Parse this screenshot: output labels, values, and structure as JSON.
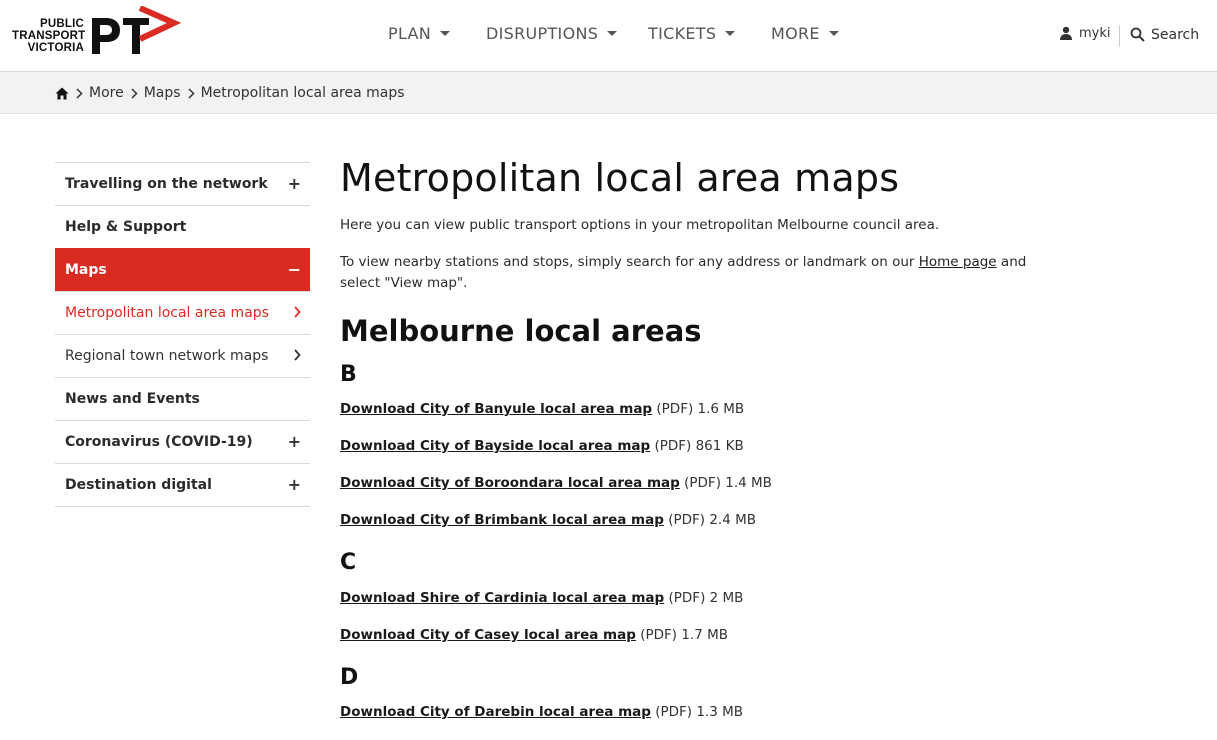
{
  "header": {
    "logo_lines": [
      "PUBLIC",
      "TRANSPORT",
      "VICTORIA"
    ],
    "logo_mark": "PT",
    "nav": [
      {
        "label": "PLAN"
      },
      {
        "label": "DISRUPTIONS"
      },
      {
        "label": "TICKETS"
      },
      {
        "label": "MORE"
      }
    ],
    "myki_label": "myki",
    "search_label": "Search",
    "brand_color": "#d92b22"
  },
  "breadcrumb": {
    "items": [
      "More",
      "Maps",
      "Metropolitan local area maps"
    ]
  },
  "sidebar": {
    "items": [
      {
        "label": "Travelling on the network",
        "control": "+"
      },
      {
        "label": "Help & Support",
        "control": ""
      },
      {
        "label": "Maps",
        "control": "−"
      },
      {
        "label": "Metropolitan local area maps",
        "control": "chevron-right"
      },
      {
        "label": "Regional town network maps",
        "control": "chevron-right"
      },
      {
        "label": "News and Events",
        "control": ""
      },
      {
        "label": "Coronavirus (COVID-19)",
        "control": "+"
      },
      {
        "label": "Destination digital",
        "control": "+"
      }
    ]
  },
  "main": {
    "title": "Metropolitan local area maps",
    "intro": "Here you can view public transport options in your metropolitan Melbourne council area.",
    "intro2_before": "To view nearby stations and stops, simply search for any address or landmark on our ",
    "intro2_link": "Home page",
    "intro2_after": " and select \"View map\".",
    "section_heading": "Melbourne local areas",
    "groups": [
      {
        "letter": "B",
        "downloads": [
          {
            "link": "Download City of Banyule local area map",
            "meta": " (PDF) 1.6 MB"
          },
          {
            "link": "Download City of Bayside local area map",
            "meta": " (PDF) 861 KB"
          },
          {
            "link": "Download City of Boroondara local area map",
            "meta": " (PDF) 1.4 MB"
          },
          {
            "link": "Download City of Brimbank local area map",
            "meta": " (PDF) 2.4 MB"
          }
        ]
      },
      {
        "letter": "C",
        "downloads": [
          {
            "link": "Download Shire of Cardinia local area map",
            "meta": " (PDF) 2 MB"
          },
          {
            "link": "Download City of Casey local area map",
            "meta": " (PDF) 1.7 MB"
          }
        ]
      },
      {
        "letter": "D",
        "downloads": [
          {
            "link": "Download City of Darebin local area map",
            "meta": " (PDF) 1.3 MB"
          }
        ]
      }
    ]
  }
}
